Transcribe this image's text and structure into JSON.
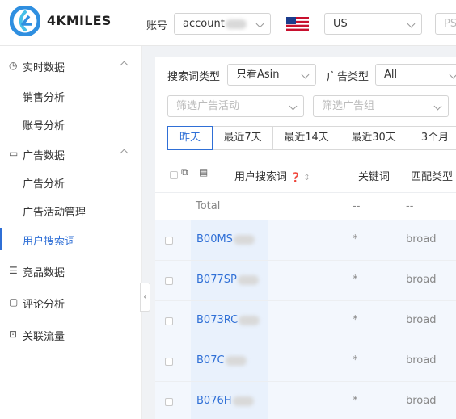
{
  "brand": {
    "name": "4KMILES",
    "color": "#2f8fe0"
  },
  "header": {
    "account_label": "账号",
    "account_value": "account",
    "country_value": "US",
    "extra_value": "PS"
  },
  "sidebar": {
    "groups": [
      {
        "label": "实时数据",
        "icon": "clock-icon",
        "items": [
          "销售分析",
          "账号分析"
        ]
      },
      {
        "label": "广告数据",
        "icon": "monitor-icon",
        "items": [
          "广告分析",
          "广告活动管理",
          "用户搜索词"
        ]
      },
      {
        "label": "竞品数据",
        "icon": "layers-icon",
        "items": []
      },
      {
        "label": "评论分析",
        "icon": "comment-icon",
        "items": []
      },
      {
        "label": "关联流量",
        "icon": "search-box-icon",
        "items": []
      }
    ],
    "active_item": "用户搜索词",
    "collapse_glyph": "‹"
  },
  "filters": {
    "search_type_label": "搜索词类型",
    "search_type_value": "只看Asin",
    "ad_type_label": "广告类型",
    "ad_type_value": "All",
    "campaign_placeholder": "筛选广告活动",
    "adgroup_placeholder": "筛选广告组"
  },
  "date_tabs": [
    "昨天",
    "最近7天",
    "最近14天",
    "最近30天",
    "3个月"
  ],
  "active_tab": "昨天",
  "table": {
    "headers": {
      "search_term": "用户搜索词",
      "keyword": "关键词",
      "match_type": "匹配类型"
    },
    "total_row": {
      "label": "Total",
      "keyword": "--",
      "match_type": "--"
    },
    "rows": [
      {
        "asin": "B00MS",
        "keyword": "*",
        "match": "broad"
      },
      {
        "asin": "B077SP",
        "keyword": "*",
        "match": "broad"
      },
      {
        "asin": "B073RC",
        "keyword": "*",
        "match": "broad"
      },
      {
        "asin": "B07C",
        "keyword": "*",
        "match": "broad"
      },
      {
        "asin": "B076H",
        "keyword": "*",
        "match": "broad"
      }
    ]
  }
}
